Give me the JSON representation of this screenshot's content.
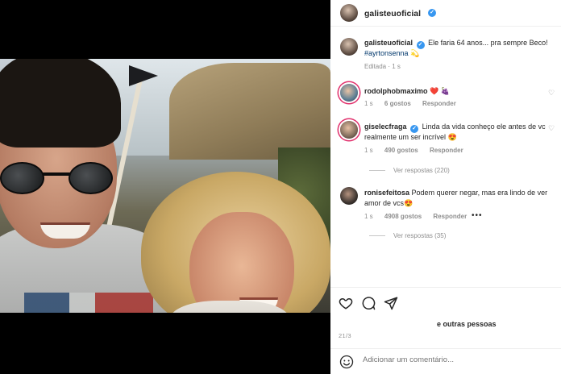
{
  "post": {
    "author": "galisteuoficial",
    "caption_text": "Ele faria 64 anos... pra sempre Beco!",
    "caption_tag": "#ayrtonsenna",
    "caption_emoji": "💫",
    "edited_label": "Editada",
    "edited_time": "1 s"
  },
  "comments": [
    {
      "user": "rodolphobmaximo",
      "text": "❤️ 🍇",
      "time": "1 s",
      "likes": "6 gostos",
      "reply": "Responder"
    },
    {
      "user": "giselecfraga",
      "text": "Linda da vida conheço ele antes de vc realmente um ser incrível 😍",
      "time": "1 s",
      "likes": "490 gostos",
      "reply": "Responder",
      "view_replies": "Ver respostas (220)"
    },
    {
      "user": "ronisefeitosa",
      "text": "Podem querer negar, mas era lindo de ver amor de vcs😍",
      "time": "1 s",
      "likes": "4908 gostos",
      "reply": "Responder",
      "more": "•••",
      "view_replies": "Ver respostas (35)"
    }
  ],
  "likes_line_suffix": "e outras pessoas",
  "date": "21/3",
  "add_comment_placeholder": "Adicionar um comentário...",
  "icons": {
    "like": "heart-icon",
    "comment": "comment-icon",
    "share": "share-icon",
    "emoji": "smiley-icon",
    "verified": "verified-badge-icon"
  },
  "colors": {
    "verified": "#3897f0",
    "hashtag": "#00376b",
    "story_ring": "#e1306c"
  }
}
